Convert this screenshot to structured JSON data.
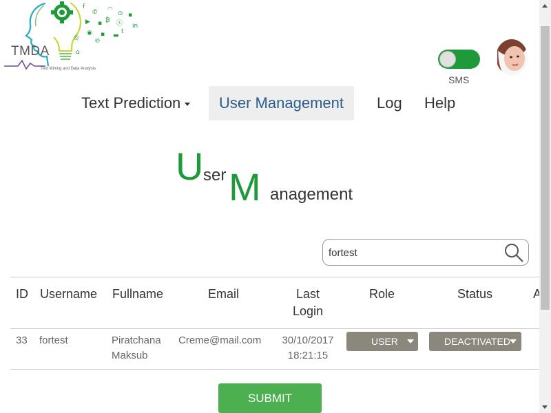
{
  "logo": {
    "name": "TMDA",
    "subtitle": "Text Mining and Data Analysis",
    "icon": "brain-lightbulb-social-icons-logo"
  },
  "header": {
    "sms_label": "SMS",
    "sms_enabled": true,
    "avatar_icon": "user-avatar"
  },
  "nav": {
    "items": [
      {
        "label": "Text Prediction",
        "has_dropdown": true,
        "active": false
      },
      {
        "label": "User Management",
        "has_dropdown": false,
        "active": true
      },
      {
        "label": "Log",
        "has_dropdown": false,
        "active": false
      },
      {
        "label": "Help",
        "has_dropdown": false,
        "active": false
      }
    ]
  },
  "page_title": {
    "first_initial": "U",
    "first_rest": "ser",
    "second_initial": "M",
    "second_rest": "anagement"
  },
  "search": {
    "value": "fortest",
    "icon": "search-icon"
  },
  "table": {
    "headers": [
      "ID",
      "Username",
      "Fullname",
      "Email",
      "Last Login",
      "Role",
      "Status",
      "A"
    ],
    "header_last_login_line1": "Last",
    "header_last_login_line2": "Login",
    "rows": [
      {
        "id": "33",
        "username": "fortest",
        "fullname_line1": "Piratchana",
        "fullname_line2": "Maksub",
        "email": "Creme@mail.com",
        "last_login_date": "30/10/2017",
        "last_login_time": "18:21:15",
        "role": "USER",
        "status": "DEACTIVATED"
      }
    ]
  },
  "submit_label": "SUBMIT",
  "colors": {
    "accent_green": "#1e9a3a",
    "submit_green": "#4caf50",
    "nav_active_text": "#2a5d8c",
    "dropdown_bg": "#8c877c"
  }
}
